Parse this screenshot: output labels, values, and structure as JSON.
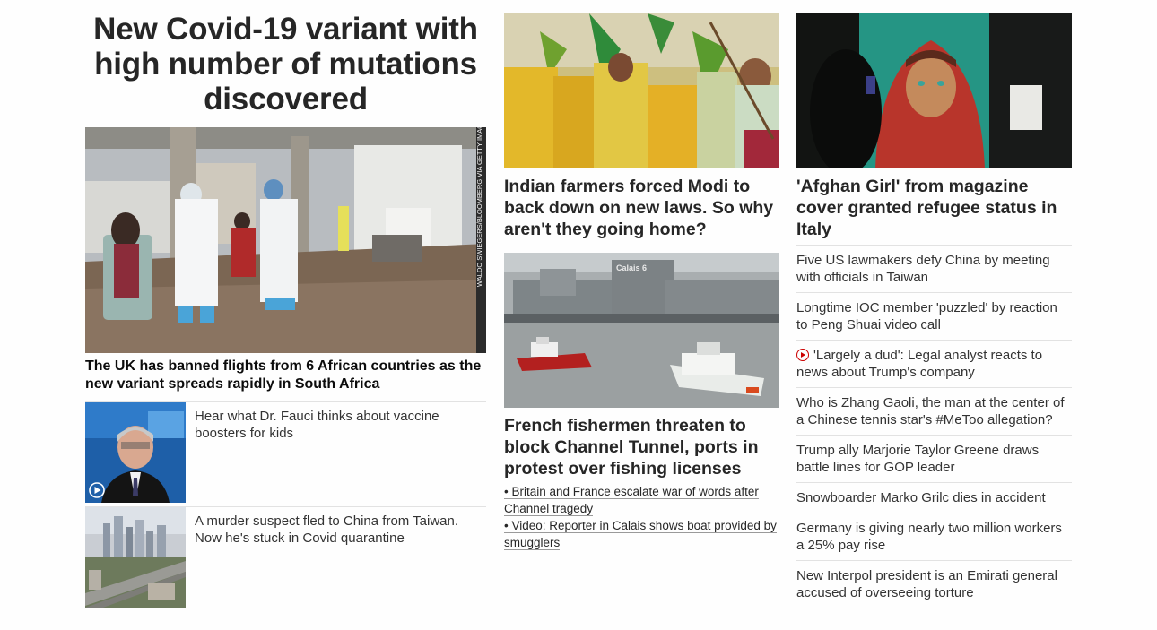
{
  "main": {
    "headline": "New Covid-19 variant with high number of mutations discovered",
    "hero_credit": "WALDO SWIEGERS/BLOOMBERG VIA GETTY IMAGES",
    "hero_caption": "The UK has banned flights from 6 African countries as the new variant spreads rapidly in South Africa",
    "small_items": [
      {
        "text": "Hear what Dr. Fauci thinks about vaccine boosters for kids",
        "video": true
      },
      {
        "text": "A murder suspect fled to China from Taiwan. Now he's stuck in Covid quarantine",
        "video": false
      }
    ]
  },
  "middle": {
    "story1": {
      "headline": "Indian farmers forced Modi to back down on new laws. So why aren't they going home?"
    },
    "story2": {
      "image_sign": "Calais 6",
      "headline": "French fishermen threaten to block Channel Tunnel, ports in protest over fishing licenses",
      "links": [
        "• Britain and France escalate war of words after Channel tragedy",
        "• Video: Reporter in Calais shows boat provided by smugglers"
      ]
    }
  },
  "right": {
    "headline": "'Afghan Girl' from magazine cover granted refugee status in Italy",
    "list": [
      "Five US lawmakers defy China by meeting with officials in Taiwan",
      "Longtime IOC member 'puzzled' by reaction to Peng Shuai video call",
      "'Largely a dud': Legal analyst reacts to news about Trump's company",
      "Who is Zhang Gaoli, the man at the center of a Chinese tennis star's #MeToo allegation?",
      "Trump ally Marjorie Taylor Greene draws battle lines for GOP leader",
      "Snowboarder Marko Grilc dies in accident",
      "Germany is giving nearly two million workers a 25% pay rise",
      "New Interpol president is an Emirati general accused of overseeing torture"
    ]
  },
  "colors": {
    "accent_red": "#cc0000",
    "text": "#0c0c0c",
    "divider": "#e2e2e2"
  }
}
